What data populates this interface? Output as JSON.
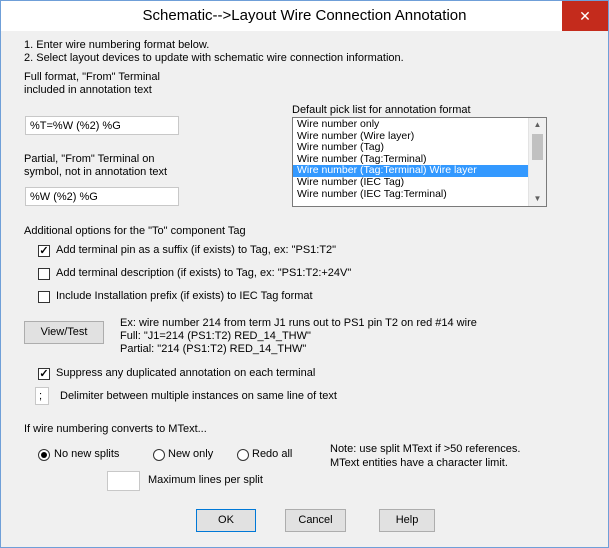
{
  "window": {
    "title": "Schematic-->Layout Wire Connection Annotation",
    "close_glyph": "✕"
  },
  "instructions": {
    "line1": "1. Enter wire numbering format below.",
    "line2": "2. Select layout devices to update with schematic wire connection information."
  },
  "full_format": {
    "label_line1": "Full format, \"From\" Terminal",
    "label_line2": "included in annotation text",
    "value": "%T=%W (%2) %G"
  },
  "partial_format": {
    "label_line1": "Partial, \"From\" Terminal on",
    "label_line2": "symbol, not in annotation text",
    "value": "%W (%2) %G"
  },
  "pick_list": {
    "label": "Default pick list for annotation format",
    "items": [
      "Wire number only",
      "Wire number (Wire layer)",
      "Wire number (Tag)",
      "Wire number (Tag:Terminal)",
      "Wire number (Tag:Terminal) Wire layer",
      "Wire number (IEC Tag)",
      "Wire number (IEC Tag:Terminal)"
    ],
    "selected_index": 4
  },
  "additional_options": {
    "heading": "Additional options for the \"To\" component Tag",
    "add_pin": {
      "label": "Add terminal pin as a suffix (if exists) to Tag, ex: \"PS1:T2\"",
      "checked": true
    },
    "add_desc": {
      "label": "Add terminal description (if exists) to Tag, ex: \"PS1:T2:+24V\"",
      "checked": false
    },
    "include_prefix": {
      "label": "Include Installation prefix (if exists) to IEC Tag format",
      "checked": false
    }
  },
  "view_test": {
    "button_label": "View/Test",
    "example_line1": "Ex: wire number 214 from term J1 runs out to PS1 pin T2 on red #14 wire",
    "example_line2": "Full: \"J1=214 (PS1:T2) RED_14_THW\"",
    "example_line3": "Partial: \"214 (PS1:T2) RED_14_THW\""
  },
  "suppress": {
    "label": "Suppress any duplicated annotation on each terminal",
    "checked": true
  },
  "delimiter": {
    "value": ";",
    "label": "Delimiter between multiple instances on same line of text"
  },
  "mtext": {
    "heading": "If wire numbering converts to MText...",
    "options": [
      {
        "label": "No new splits",
        "selected": true
      },
      {
        "label": "New only",
        "selected": false
      },
      {
        "label": "Redo all",
        "selected": false
      }
    ],
    "note_line1": "Note: use split MText if >50 references.",
    "note_line2": "MText entities have a character limit.",
    "max_lines_value": "",
    "max_lines_label": "Maximum lines per split"
  },
  "buttons": {
    "ok": "OK",
    "cancel": "Cancel",
    "help": "Help"
  }
}
